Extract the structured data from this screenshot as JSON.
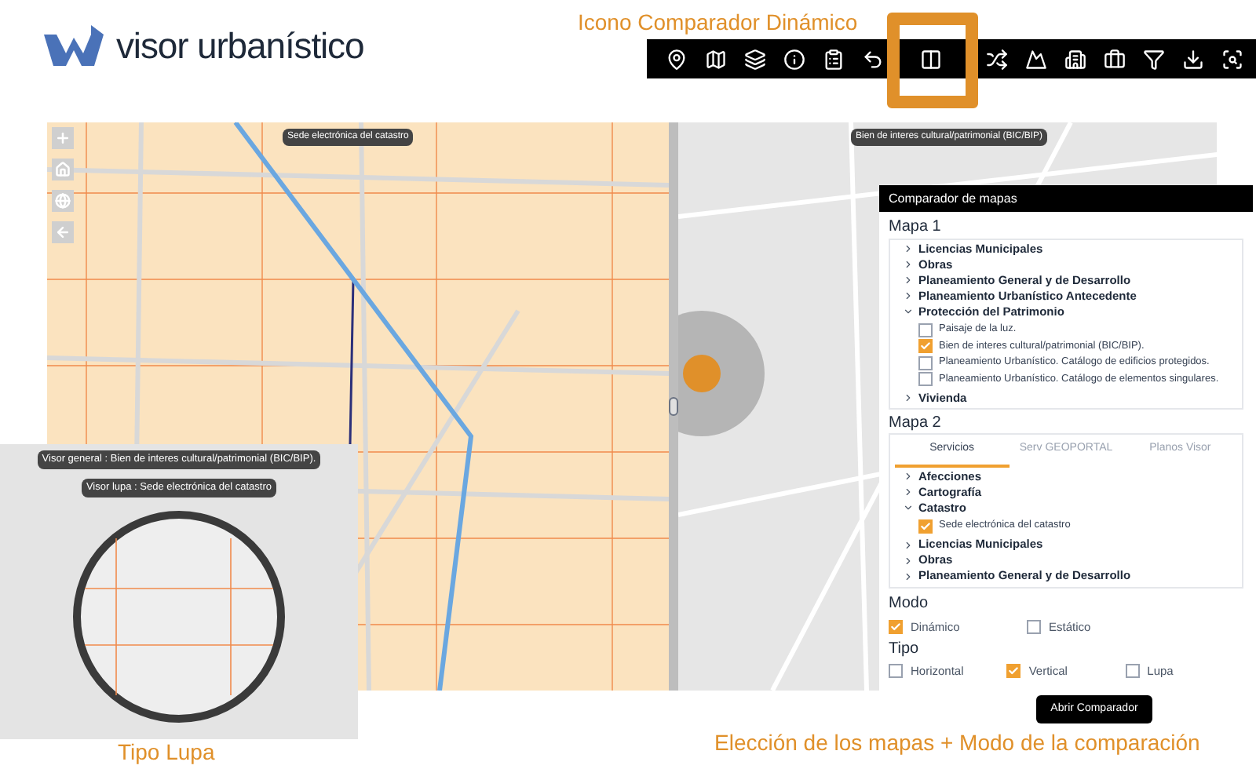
{
  "header": {
    "logo_text": "visor urbanístico"
  },
  "annotations": {
    "toolbar": "Icono Comparador Dinámico",
    "lupa": "Tipo Lupa",
    "panel": "Elección de los mapas + Modo de la comparación"
  },
  "map": {
    "left_layer": "Sede electrónica del catastro",
    "right_layer": "Bien de interes cultural/patrimonial (BIC/BIP)"
  },
  "lupa": {
    "general": "Visor general : Bien de interes cultural/patrimonial (BIC/BIP).",
    "lupa": "Visor lupa : Sede electrónica del catastro"
  },
  "panel": {
    "title": "Comparador de mapas",
    "map1": {
      "heading": "Mapa 1",
      "tree": [
        {
          "label": "Licencias Municipales",
          "expanded": false
        },
        {
          "label": "Obras",
          "expanded": false
        },
        {
          "label": "Planeamiento General y de Desarrollo",
          "expanded": false
        },
        {
          "label": "Planeamiento Urbanístico Antecedente",
          "expanded": false
        },
        {
          "label": "Protección del Patrimonio",
          "expanded": true,
          "children": [
            {
              "label": "Paisaje de la luz.",
              "checked": false
            },
            {
              "label": "Bien de interes cultural/patrimonial (BIC/BIP).",
              "checked": true
            },
            {
              "label": "Planeamiento Urbanístico. Catálogo de edificios protegidos.",
              "checked": false
            },
            {
              "label": "Planeamiento Urbanístico. Catálogo de elementos singulares.",
              "checked": false
            }
          ]
        },
        {
          "label": "Vivienda",
          "expanded": false
        }
      ]
    },
    "map2": {
      "heading": "Mapa 2",
      "tabs": [
        {
          "label": "Servicios",
          "selected": true
        },
        {
          "label": "Serv GEOPORTAL",
          "selected": false
        },
        {
          "label": "Planos Visor",
          "selected": false
        }
      ],
      "tree": [
        {
          "label": "Afecciones",
          "expanded": false
        },
        {
          "label": "Cartografía",
          "expanded": false
        },
        {
          "label": "Catastro",
          "expanded": true,
          "children": [
            {
              "label": "Sede electrónica del catastro",
              "checked": true
            }
          ]
        },
        {
          "label": "Licencias Municipales",
          "expanded": false
        },
        {
          "label": "Obras",
          "expanded": false
        },
        {
          "label": "Planeamiento General y de Desarrollo",
          "expanded": false
        }
      ]
    },
    "modo": {
      "heading": "Modo",
      "options": [
        {
          "label": "Dinámico",
          "checked": true
        },
        {
          "label": "Estático",
          "checked": false
        }
      ]
    },
    "tipo": {
      "heading": "Tipo",
      "options": [
        {
          "label": "Horizontal",
          "checked": false
        },
        {
          "label": "Vertical",
          "checked": true
        },
        {
          "label": "Lupa",
          "checked": false
        }
      ]
    },
    "button": "Abrir Comparador"
  }
}
